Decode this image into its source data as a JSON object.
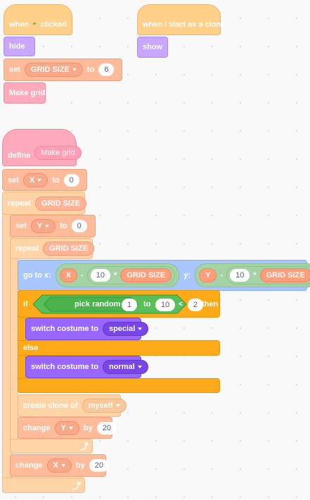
{
  "colors": {
    "events": "#ffd08a",
    "looks": "#c9a6ff",
    "looks_dark": "#9966ff",
    "variables": "#ffbb9a",
    "control": "#ffd4a6",
    "control_active": "#ffab19",
    "my_blocks": "#ffa9bd",
    "motion": "#a8c6ff",
    "operators": "#59c059"
  },
  "script1": {
    "when": "when",
    "flag_icon": "green-flag-icon",
    "clicked": "clicked",
    "hide": "hide",
    "set": "set",
    "var": "GRID SIZE",
    "to": "to",
    "value": "6",
    "call": "Make grid"
  },
  "script2": {
    "hat": "when I start as a clone",
    "show": "show"
  },
  "script3": {
    "define": "define",
    "define_name": "Make grid",
    "set_x": {
      "label": "set",
      "var": "X",
      "to": "to",
      "value": "0"
    },
    "repeat_outer": {
      "label": "repeat",
      "arg": "GRID SIZE"
    },
    "set_y": {
      "label": "set",
      "var": "Y",
      "to": "to",
      "value": "0"
    },
    "repeat_inner": {
      "label": "repeat",
      "arg": "GRID SIZE"
    },
    "goto": {
      "label": "go to x:",
      "x_var": "X",
      "x_minus": "-",
      "x_num": "10",
      "x_times": "*",
      "x_grid": "GRID SIZE",
      "y_label": "y:",
      "y_var": "Y",
      "y_minus": "-",
      "y_num": "10",
      "y_times": "*",
      "y_grid": "GRID SIZE"
    },
    "if_else": {
      "if": "if",
      "pick_random": "pick random",
      "from": "1",
      "to_label": "to",
      "to": "10",
      "lt": "<",
      "compare": "2",
      "then": "then",
      "switch1": "switch costume to",
      "costume1": "special",
      "else": "else",
      "switch2": "switch costume to",
      "costume2": "normal"
    },
    "create_clone": {
      "label": "create clone of",
      "target": "myself"
    },
    "change_y": {
      "label": "change",
      "var": "Y",
      "by": "by",
      "value": "20"
    },
    "change_x": {
      "label": "change",
      "var": "X",
      "by": "by",
      "value": "20"
    },
    "loop_icon": "loop-arrow-icon"
  }
}
